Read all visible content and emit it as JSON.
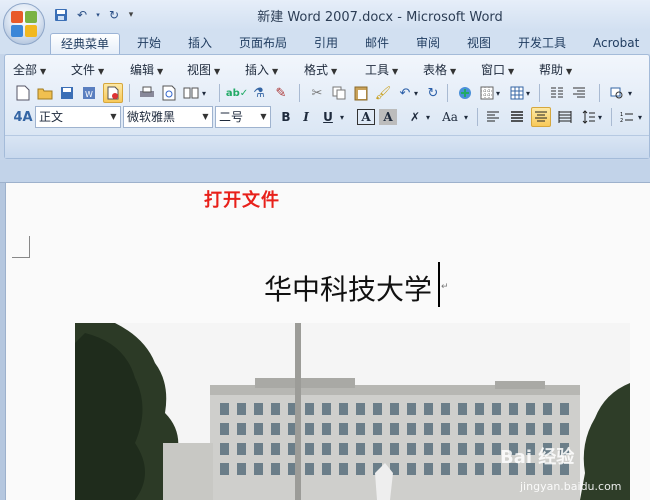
{
  "window": {
    "title": "新建 Word 2007.docx - Microsoft Word"
  },
  "quick_access": [
    {
      "name": "save-icon",
      "glyph": "💾"
    },
    {
      "name": "undo-icon",
      "glyph": "↶"
    },
    {
      "name": "redo-icon",
      "glyph": "↻"
    },
    {
      "name": "customize-icon",
      "glyph": "▾"
    }
  ],
  "tabs": [
    {
      "label": "经典菜单",
      "active": true
    },
    {
      "label": "开始"
    },
    {
      "label": "插入"
    },
    {
      "label": "页面布局"
    },
    {
      "label": "引用"
    },
    {
      "label": "邮件"
    },
    {
      "label": "审阅"
    },
    {
      "label": "视图"
    },
    {
      "label": "开发工具"
    },
    {
      "label": "Acrobat"
    }
  ],
  "menus": [
    "全部",
    "文件",
    "编辑",
    "视图",
    "插入",
    "格式",
    "工具",
    "表格",
    "窗口",
    "帮助"
  ],
  "format": {
    "style": "正文",
    "font": "微软雅黑",
    "size": "二号",
    "bold": "B",
    "italic": "I",
    "underline": "U",
    "char_border": "A",
    "char_shade": "A",
    "change_case": "Aa"
  },
  "document": {
    "annotation": "打开文件",
    "heading": "华中科技大学"
  },
  "watermark": {
    "brand": "Bai 经验",
    "url": "jingyan.baidu.com"
  },
  "colors": {
    "annotation": "#e8201a",
    "accent": "#f8c95a"
  }
}
